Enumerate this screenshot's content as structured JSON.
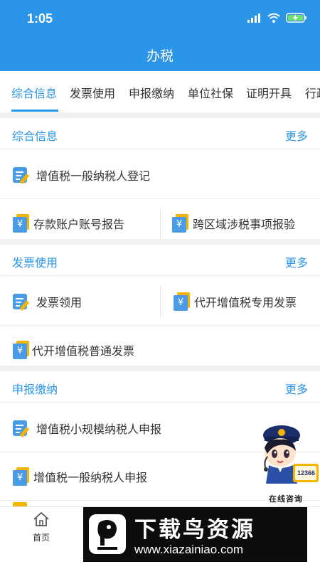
{
  "status": {
    "time": "1:05"
  },
  "nav": {
    "title": "办税"
  },
  "tabs": [
    {
      "label": "综合信息",
      "active": true
    },
    {
      "label": "发票使用"
    },
    {
      "label": "申报缴纳"
    },
    {
      "label": "单位社保"
    },
    {
      "label": "证明开具"
    },
    {
      "label": "行政"
    }
  ],
  "sections": [
    {
      "title": "综合信息",
      "more": "更多",
      "items": [
        {
          "label": "增值税一般纳税人登记",
          "icon": "form-pen-icon"
        },
        {
          "label": "存款账户账号报告",
          "icon": "yen-card-icon"
        },
        {
          "label": "跨区域涉税事项报验",
          "icon": "yen-card-icon"
        }
      ]
    },
    {
      "title": "发票使用",
      "more": "更多",
      "items": [
        {
          "label": "发票领用",
          "icon": "form-pen-icon"
        },
        {
          "label": "代开增值税专用发票",
          "icon": "yen-card-icon"
        },
        {
          "label": "代开增值税普通发票",
          "icon": "yen-card-icon"
        }
      ]
    },
    {
      "title": "申报缴纳",
      "more": "更多",
      "items": [
        {
          "label": "增值税小规模纳税人申报",
          "icon": "form-pen-icon"
        },
        {
          "label": "增值税一般纳税人申报",
          "icon": "yen-card-icon"
        }
      ]
    }
  ],
  "bottom_nav": {
    "home_label": "首页"
  },
  "consult": {
    "label": "在线咨询",
    "hotline": "12366"
  },
  "watermark": {
    "title": "下载鸟资源",
    "url": "www.xiazainiao.com"
  },
  "colors": {
    "primary": "#2b95e8",
    "accent": "#f5b400"
  }
}
